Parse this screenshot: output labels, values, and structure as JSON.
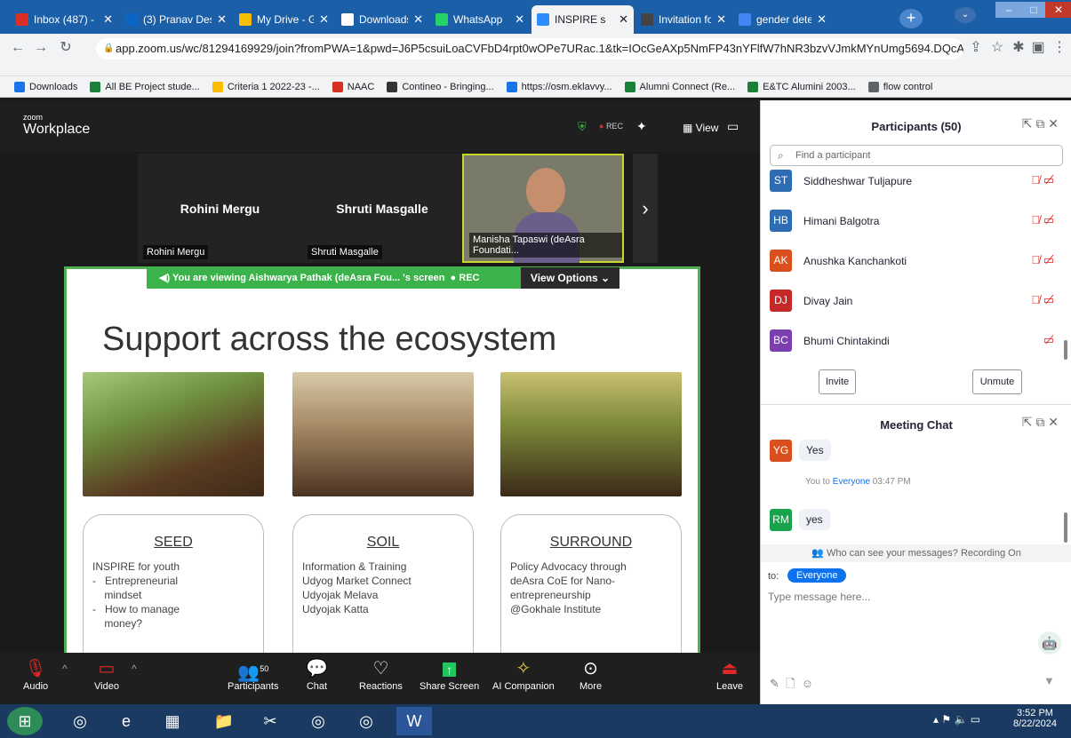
{
  "browser": {
    "tabs": [
      {
        "title": "Inbox (487) - ",
        "color": "#d93025",
        "active": false
      },
      {
        "title": "(3) Pranav Des",
        "color": "#0a66c2",
        "active": false
      },
      {
        "title": "My Drive - Goo",
        "color": "#fbbc04",
        "active": false
      },
      {
        "title": "Downloads",
        "color": "#ffffff",
        "active": false
      },
      {
        "title": "WhatsApp",
        "color": "#25d366",
        "active": false
      },
      {
        "title": "INSPIRE s",
        "color": "#2d8cff",
        "active": true
      },
      {
        "title": "Invitation for ",
        "color": "#444444",
        "active": false
      },
      {
        "title": "gender detect",
        "color": "#4285f4",
        "active": false
      }
    ],
    "url": "app.zoom.us/wc/81294169929/join?fromPWA=1&pwd=J6P5csuiLoaCVFbD4rpt0wOPe7URac.1&tk=IOcGeAXp5NmFP43nYFlfW7hNR3bzvVJmkMYnUmg5694.DQcA...",
    "bookmarks": [
      "Downloads",
      "All BE Project stude...",
      "Criteria 1 2022-23 -...",
      "NAAC",
      "Contineo - Bringing...",
      "https://osm.eklavvy...",
      "Alumni Connect (Re...",
      "E&TC Alumini 2003...",
      "flow control"
    ]
  },
  "zoom": {
    "logo_small": "zoom",
    "logo_big": "Workplace",
    "rec": "REC",
    "view": "View",
    "thumbs": [
      {
        "name": "Rohini Mergu",
        "label": "Rohini Mergu"
      },
      {
        "name": "Shruti Masgalle",
        "label": "Shruti Masgalle"
      },
      {
        "name": "",
        "label": "Manisha Tapaswi (deAsra Foundati..."
      }
    ],
    "viewing": "You are viewing  Aishwarya Pathak (deAsra Fou... 's screen",
    "viewing_rec": "REC",
    "view_options": "View Options",
    "slide": {
      "title": "Support across the ecosystem",
      "cards": [
        {
          "heading": "SEED",
          "lines": [
            "INSPIRE for youth",
            "-   Entrepreneurial",
            "    mindset",
            "-   How to manage",
            "    money?"
          ]
        },
        {
          "heading": "SOIL",
          "lines": [
            "Information & Training",
            "Udyog Market Connect",
            "Udyojak Melava",
            "Udyojak Katta"
          ]
        },
        {
          "heading": "SURROUND",
          "lines": [
            "Policy Advocacy through",
            "deAsra CoE for Nano-",
            "entrepreneurship",
            "@Gokhale Institute"
          ]
        }
      ]
    },
    "toolbar": [
      "Audio",
      "Video",
      "Participants",
      "Chat",
      "Reactions",
      "Share Screen",
      "AI Companion",
      "More",
      "Leave"
    ],
    "participant_count": "50"
  },
  "panel": {
    "participants_title": "Participants (50)",
    "search_placeholder": "Find a participant",
    "participants": [
      {
        "initials": "ST",
        "name": "Siddheshwar Tuljapure",
        "color": "#2e6db4"
      },
      {
        "initials": "HB",
        "name": "Himani Balgotra",
        "color": "#2e6db4"
      },
      {
        "initials": "AK",
        "name": "Anushka Kanchankoti",
        "color": "#d9501e"
      },
      {
        "initials": "DJ",
        "name": "Divay Jain",
        "color": "#c62828"
      },
      {
        "initials": "BC",
        "name": "Bhumi Chintakindi",
        "color": "#7b3fb0"
      }
    ],
    "invite": "Invite",
    "unmute": "Unmute",
    "chat_title": "Meeting Chat",
    "chat": [
      {
        "initials": "YG",
        "color": "#d9501e",
        "text": "Yes"
      },
      {
        "meta": "You to ",
        "to": "Everyone",
        "time": " 03:47 PM"
      },
      {
        "initials": "RM",
        "color": "#16a34a",
        "text": "yes"
      }
    ],
    "notice": "Who can see your messages? Recording On",
    "to_label": "to:",
    "to_value": "Everyone",
    "input_placeholder": "Type message here..."
  },
  "taskbar": {
    "time": "3:52 PM",
    "date": "8/22/2024"
  }
}
